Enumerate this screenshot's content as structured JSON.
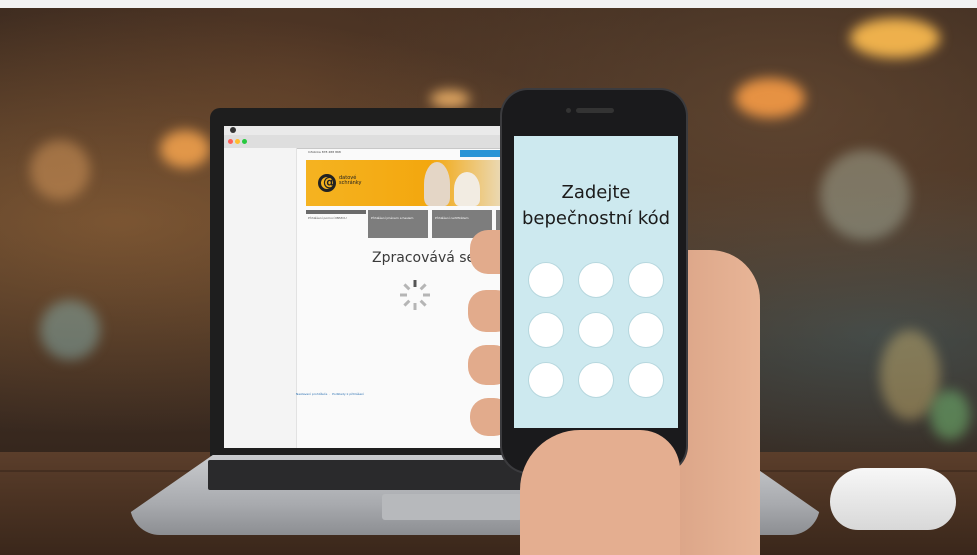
{
  "laptop": {
    "hotline": "Infolinka 878 488 868",
    "logo_text_1": "datové",
    "logo_text_2": "schránky",
    "menu_label": "Přihlášení pomocí IBEZCU",
    "tile_1": "Přihlášení jménem a heslem",
    "tile_2": "Přihlášení certifikátem",
    "processing": "Zpracovává se",
    "footer_link_1": "Nastavení prohlížeče",
    "footer_link_2": "Podklady k přihlášení"
  },
  "phone": {
    "prompt_line_1": "Zadejte",
    "prompt_line_2": "bepečnostní kód",
    "pin_digits_total": 9
  },
  "colors": {
    "phone_screen": "#cde9ef",
    "banner": "#f3a70e",
    "login_button": "#2a95d6"
  }
}
